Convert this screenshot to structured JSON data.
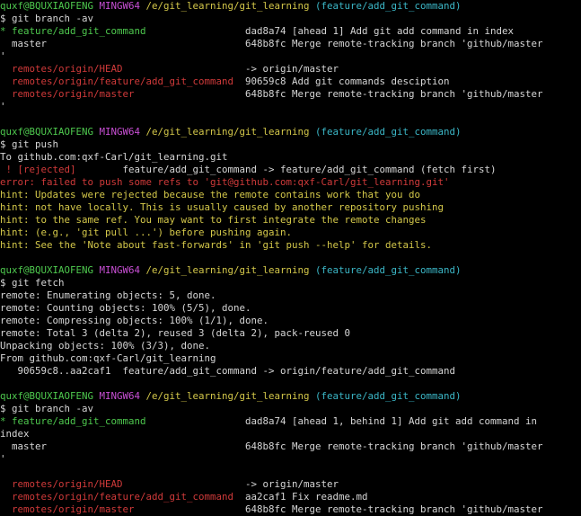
{
  "colors": {
    "background": "#000000",
    "default": "#d6d6d6",
    "green": "#4ec94e",
    "magenta": "#c84fd4",
    "yellow": "#d4c84a",
    "cyan": "#3bb7c7",
    "red": "#d03a3a"
  },
  "lines": [
    [
      {
        "t": "quxf@BQUXIAOFENG ",
        "c": "green"
      },
      {
        "t": "MINGW64 ",
        "c": "magenta"
      },
      {
        "t": "/e/git_learning/git_learning ",
        "c": "yellow"
      },
      {
        "t": "(feature/add_git_command)",
        "c": "cyan"
      }
    ],
    [
      {
        "t": "$ git branch -av",
        "c": "white"
      }
    ],
    [
      {
        "t": "* feature/add_git_command                 ",
        "c": "green"
      },
      {
        "t": "dad8a74 [ahead 1] Add git add command in index",
        "c": "white"
      }
    ],
    [
      {
        "t": "  master                                  648b8fc Merge remote-tracking branch 'github/master",
        "c": "white"
      }
    ],
    [
      {
        "t": "'",
        "c": "white"
      }
    ],
    [
      {
        "t": "  remotes/origin/HEAD                     ",
        "c": "red"
      },
      {
        "t": "-> origin/master",
        "c": "white"
      }
    ],
    [
      {
        "t": "  remotes/origin/feature/add_git_command  ",
        "c": "red"
      },
      {
        "t": "90659c8 Add git commands desciption",
        "c": "white"
      }
    ],
    [
      {
        "t": "  remotes/origin/master                   ",
        "c": "red"
      },
      {
        "t": "648b8fc Merge remote-tracking branch 'github/master",
        "c": "white"
      }
    ],
    [
      {
        "t": "'",
        "c": "white"
      }
    ],
    [],
    [
      {
        "t": "quxf@BQUXIAOFENG ",
        "c": "green"
      },
      {
        "t": "MINGW64 ",
        "c": "magenta"
      },
      {
        "t": "/e/git_learning/git_learning ",
        "c": "yellow"
      },
      {
        "t": "(feature/add_git_command)",
        "c": "cyan"
      }
    ],
    [
      {
        "t": "$ git push",
        "c": "white"
      }
    ],
    [
      {
        "t": "To github.com:qxf-Carl/git_learning.git",
        "c": "white"
      }
    ],
    [
      {
        "t": " ! [rejected]        ",
        "c": "red"
      },
      {
        "t": "feature/add_git_command -> feature/add_git_command (fetch first)",
        "c": "white"
      }
    ],
    [
      {
        "t": "error: failed to push some refs to 'git@github.com:qxf-Carl/git_learning.git'",
        "c": "red"
      }
    ],
    [
      {
        "t": "hint: Updates were rejected because the remote contains work that you do",
        "c": "yellow"
      }
    ],
    [
      {
        "t": "hint: not have locally. This is usually caused by another repository pushing",
        "c": "yellow"
      }
    ],
    [
      {
        "t": "hint: to the same ref. You may want to first integrate the remote changes",
        "c": "yellow"
      }
    ],
    [
      {
        "t": "hint: (e.g., 'git pull ...') before pushing again.",
        "c": "yellow"
      }
    ],
    [
      {
        "t": "hint: See the 'Note about fast-forwards' in 'git push --help' for details.",
        "c": "yellow"
      }
    ],
    [],
    [
      {
        "t": "quxf@BQUXIAOFENG ",
        "c": "green"
      },
      {
        "t": "MINGW64 ",
        "c": "magenta"
      },
      {
        "t": "/e/git_learning/git_learning ",
        "c": "yellow"
      },
      {
        "t": "(feature/add_git_command)",
        "c": "cyan"
      }
    ],
    [
      {
        "t": "$ git fetch",
        "c": "white"
      }
    ],
    [
      {
        "t": "remote: Enumerating objects: 5, done.",
        "c": "white"
      }
    ],
    [
      {
        "t": "remote: Counting objects: 100% (5/5), done.",
        "c": "white"
      }
    ],
    [
      {
        "t": "remote: Compressing objects: 100% (1/1), done.",
        "c": "white"
      }
    ],
    [
      {
        "t": "remote: Total 3 (delta 2), reused 3 (delta 2), pack-reused 0",
        "c": "white"
      }
    ],
    [
      {
        "t": "Unpacking objects: 100% (3/3), done.",
        "c": "white"
      }
    ],
    [
      {
        "t": "From github.com:qxf-Carl/git_learning",
        "c": "white"
      }
    ],
    [
      {
        "t": "   90659c8..aa2caf1  feature/add_git_command -> origin/feature/add_git_command",
        "c": "white"
      }
    ],
    [],
    [
      {
        "t": "quxf@BQUXIAOFENG ",
        "c": "green"
      },
      {
        "t": "MINGW64 ",
        "c": "magenta"
      },
      {
        "t": "/e/git_learning/git_learning ",
        "c": "yellow"
      },
      {
        "t": "(feature/add_git_command)",
        "c": "cyan"
      }
    ],
    [
      {
        "t": "$ git branch -av",
        "c": "white"
      }
    ],
    [
      {
        "t": "* feature/add_git_command                 ",
        "c": "green"
      },
      {
        "t": "dad8a74 [ahead 1, behind 1] Add git add command in",
        "c": "white"
      }
    ],
    [
      {
        "t": "index",
        "c": "white"
      }
    ],
    [
      {
        "t": "  master                                  648b8fc Merge remote-tracking branch 'github/master",
        "c": "white"
      }
    ],
    [
      {
        "t": "'",
        "c": "white"
      }
    ],
    [],
    [
      {
        "t": "  remotes/origin/HEAD                     ",
        "c": "red"
      },
      {
        "t": "-> origin/master",
        "c": "white"
      }
    ],
    [
      {
        "t": "  remotes/origin/feature/add_git_command  ",
        "c": "red"
      },
      {
        "t": "aa2caf1 Fix readme.md",
        "c": "white"
      }
    ],
    [
      {
        "t": "  remotes/origin/master                   ",
        "c": "red"
      },
      {
        "t": "648b8fc Merge remote-tracking branch 'github/master",
        "c": "white"
      }
    ],
    [
      {
        "t": "'",
        "c": "white"
      }
    ]
  ]
}
